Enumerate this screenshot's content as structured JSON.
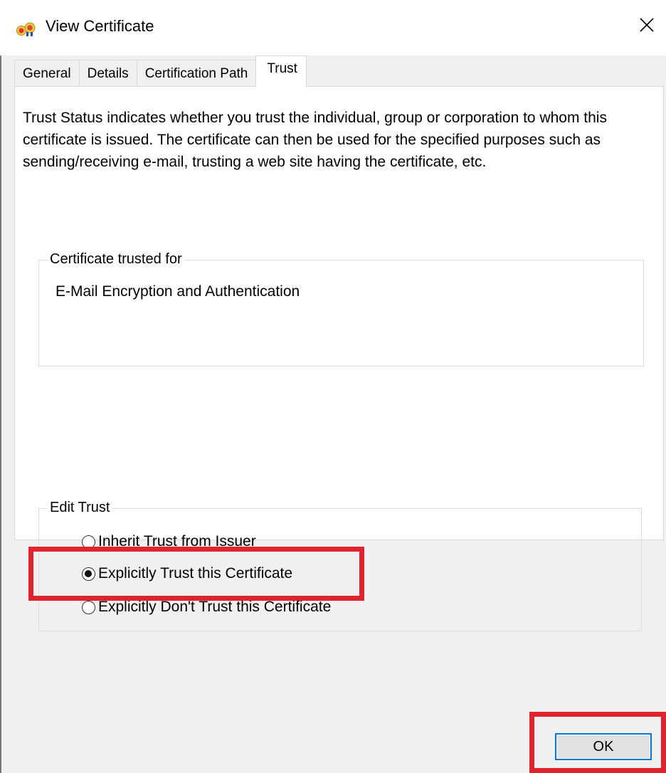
{
  "window": {
    "title": "View Certificate",
    "title_icon": "certificate-icon",
    "close_glyph": "✕",
    "close_icon": "close-icon"
  },
  "tabs": [
    {
      "label": "General",
      "active": false
    },
    {
      "label": "Details",
      "active": false
    },
    {
      "label": "Certification Path",
      "active": false
    },
    {
      "label": "Trust",
      "active": true
    }
  ],
  "trust": {
    "description": "Trust Status indicates whether you trust the individual, group or corporation to whom this certificate is issued.  The certificate can then be used for the specified purposes such as sending/receiving e-mail, trusting a web site having the certificate, etc.",
    "trusted_for": {
      "legend": "Certificate trusted for",
      "value": "E-Mail Encryption and Authentication"
    },
    "edit_trust": {
      "legend": "Edit Trust",
      "options": [
        {
          "label": "Inherit Trust from Issuer",
          "checked": false
        },
        {
          "label": "Explicitly Trust this Certificate",
          "checked": true
        },
        {
          "label": "Explicitly Don't Trust this Certificate",
          "checked": false
        }
      ]
    }
  },
  "footer": {
    "ok_label": "OK"
  },
  "colors": {
    "highlight": "#e0242e",
    "focus_border": "#0078d7",
    "panel_bg": "#ffffff",
    "dialog_bg": "#f0f0f0"
  }
}
